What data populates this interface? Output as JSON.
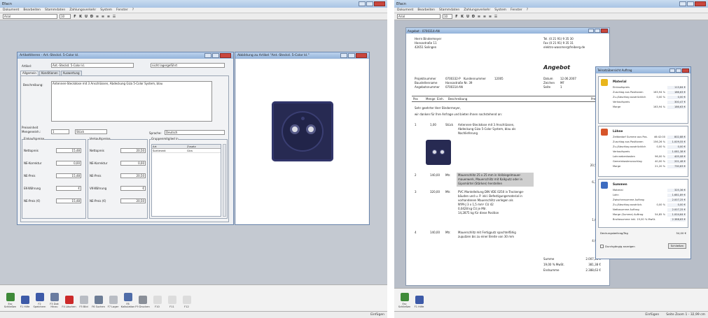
{
  "left_app": {
    "title": "Efacn",
    "menu": [
      "Dokument",
      "Bearbeiten",
      "Stammdaten",
      "Zahlungsverkehr",
      "System",
      "Fenster",
      "?"
    ],
    "font_name": "Arial",
    "font_size": "10",
    "format_buttons": [
      "F",
      "K",
      "U",
      "Ð",
      "≡",
      "≡",
      "≡",
      "☰"
    ],
    "article_window": {
      "title": "Artikeltiteren - Art.-Steckd. 5-Color kl.",
      "artikel_label": "Artikel:",
      "artikel_value": "Ant.-Steckd. 5-Color kl.",
      "lager_value": "nicht lagergeführt",
      "tabs": [
        "Allgemein",
        "Konditionen",
        "Auswertung"
      ],
      "beschreibung_label": "Beschreibung:",
      "beschreibung_value": "Antennen-Steckdose mit 3 Anschlüssen, Abdeckung Giza 5-Color System, blau",
      "preiseinheit_label": "Preiseinheit",
      "mengeneinh_label": "Mengeneinh.:",
      "preiseinheit_value": "1",
      "mengeneinh_value": "Stück",
      "sprache_label": "Sprache:",
      "sprache_value": "Deutsch",
      "gruppen_label": "Gruppenmitglied in",
      "gruppen_headers": [
        "Art",
        "Zusatz"
      ],
      "gruppen_row": [
        "Sortiment",
        "Gira"
      ],
      "einkauf_label": "Einkaufspreise",
      "verkauf_label": "Verkaufspreise",
      "einkauf_rows": [
        {
          "label": "Nettopreis",
          "value": "15,48"
        },
        {
          "label": "NE-Korrektur",
          "value": "0,00"
        },
        {
          "label": "NE-Preis",
          "value": "15,48"
        },
        {
          "label": "EK-Währung",
          "value": "€"
        },
        {
          "label": "NE-Preis (€)",
          "value": "15,48"
        }
      ],
      "verkauf_rows": [
        {
          "label": "Nettopreis",
          "value": "20,50"
        },
        {
          "label": "NE-Korrektur",
          "value": "0,00"
        },
        {
          "label": "NE-Preis",
          "value": "20,50"
        },
        {
          "label": "VK-Währung",
          "value": "€"
        },
        {
          "label": "NE-Preis (€)",
          "value": "20,50"
        }
      ]
    },
    "image_window": {
      "title": "Abbildung zu Artikel \"Ant.-Steckd. 5-Color kl.\""
    },
    "bottom_buttons": [
      {
        "label": "Esc Schließen",
        "icon": "close-door-icon",
        "color": "#3f8a3a"
      },
      {
        "label": "F1 Hilfe",
        "icon": "help-icon",
        "color": "#3d5aa8"
      },
      {
        "label": "F2 Speichern",
        "icon": "save-icon",
        "color": "#3d5aa8"
      },
      {
        "label": "F3 Dok Hinzu",
        "icon": "document-icon",
        "color": "#6a7ca0"
      },
      {
        "label": "F4 Löschen",
        "icon": "delete-icon",
        "color": "#cc2a2a"
      },
      {
        "label": "F5 Bild",
        "icon": "image-icon",
        "color": "#b9bdc4"
      },
      {
        "label": "F6 Suchen",
        "icon": "search-icon",
        "color": "#6d7d96"
      },
      {
        "label": "F7 Lager",
        "icon": "warehouse-icon",
        "color": "#b9bdc4"
      },
      {
        "label": "F8 Kalkulation",
        "icon": "calculator-icon",
        "color": "#4f6ca8"
      },
      {
        "label": "F9 Drucken",
        "icon": "print-icon",
        "color": "#8a8f98"
      },
      {
        "label": "F10",
        "icon": "blank-icon",
        "color": "#dcdcdc"
      },
      {
        "label": "F11",
        "icon": "blank-icon",
        "color": "#dcdcdc"
      },
      {
        "label": "F12",
        "icon": "blank-icon",
        "color": "#dcdcdc"
      }
    ],
    "status": "Einfügen"
  },
  "right_app": {
    "title": "Efacn",
    "menu": [
      "Dokument",
      "Bearbeiten",
      "Stammdaten",
      "Zahlungsverkehr",
      "System",
      "Fenster",
      "?"
    ],
    "font_name": "Arial",
    "font_size": "10",
    "doc_window_title": "Angebot - 0700314-AN",
    "doc": {
      "address": [
        "Herrn Bindermeyer",
        "Hansastraße 11",
        "42651 Solingen"
      ],
      "contact": [
        "Tel. (0 21 91) 9 35 30",
        "Fax (0 21 91) 9 35 31",
        "elektro-wassmer@freiberg.de"
      ],
      "heading": "Angebot",
      "meta_left": [
        {
          "label": "Projektnummer",
          "value": "0700332-P"
        },
        {
          "label": "Kundennummer",
          "value": "12005"
        },
        {
          "label": "Baustellenname",
          "value": "Hansastraße Nr. 39"
        },
        {
          "label": "Angebotsnummer",
          "value": "0700314-AN"
        }
      ],
      "meta_right": [
        {
          "label": "Datum",
          "value": "12.06.2007"
        },
        {
          "label": "Zeichen",
          "value": "MF"
        },
        {
          "label": "Seite",
          "value": "1"
        }
      ],
      "table_headers": [
        "Pos",
        "Menge",
        "Einh.",
        "Beschreibung",
        "Preis"
      ],
      "salutation": "Sehr geehrter Herr Bindermeyer,",
      "intro": "wir danken für Ihre Anfrage und bieten Ihnen nachstehend an:",
      "positions": [
        {
          "pos": "1",
          "menge": "1,00",
          "einh": "Stück",
          "text": [
            "Antennen-Steckdose mit 3 Anschlüssen,",
            "Abdeckung Giza 5-Color System, blau als",
            "Nachlieferung"
          ],
          "preis": "20,50 €",
          "highlight": false
        },
        {
          "pos": "2",
          "menge": "140,00",
          "einh": "Mtr.",
          "text": [
            "Mauerschlitz 25 x 25 mm in Vollziegelmauer-",
            "mauerwerk, Mauerschlitz mit Kalkputz oder in",
            "Gipsmörtel (Stärken) herstellen"
          ],
          "preis": "6,35 €",
          "highlight": true
        },
        {
          "pos": "3",
          "menge": "320,00",
          "einh": "Mtr.",
          "text": [
            "PVC Mantelleitung DIN VDE 0250 in Trockenge-",
            "bäuden und u. P. inkl. Befestigungsmaterial in",
            "vorhandenen Mauerschlitz verlegen als",
            "NYM-J 3 x 1,5 mm² CU 42",
            "0,0428 kg CU je Mtr.",
            "14,2875 kg für diese Position"
          ],
          "preis": "1,07 €",
          "highlight": false
        },
        {
          "pos": "4",
          "menge": "140,00",
          "einh": "Mtr.",
          "text": [
            "Mauerschlitz mit Fertigputz spachtelfähig",
            "zuputzen bis zu einer Breite von 30 mm"
          ],
          "preis": "4,93 €",
          "highlight": false
        }
      ],
      "totals": [
        {
          "label": "Summe",
          "value": "2.007,25 €"
        },
        {
          "label": "19,00 % MwSt.",
          "value": "381,38 €"
        },
        {
          "label": "Endsumme",
          "value": "2.388,63 €"
        }
      ]
    },
    "calc_window": {
      "title": "Teilsatzübersicht Auftrag",
      "sections": [
        {
          "name": "Material",
          "icon": "material-icon",
          "rows": [
            {
              "label": "Einkaufspreis",
              "pct": "",
              "value": "113,84 €"
            },
            {
              "label": "Zuschlag aus Positionen",
              "pct": "163,94 %",
              "value": "186,63 €"
            },
            {
              "label": "Zu-/Abschlag ausdrücklich",
              "pct": "0,00 %",
              "value": "0,00 €"
            },
            {
              "label": "Verkaufspreis",
              "pct": "",
              "value": "300,47 €"
            },
            {
              "label": "Marge",
              "pct": "163,94 %",
              "value": "186,63 €"
            }
          ]
        },
        {
          "name": "Löhne",
          "icon": "labor-icon",
          "rows": [
            {
              "label": "Zeitbedarf Summe aus Pos.",
              "pct": "46:42:00",
              "value": "802,88 €"
            },
            {
              "label": "Zuschlag aus Positionen",
              "pct": "156,26 %",
              "value": "1.009,55 €"
            },
            {
              "label": "Zu-/Abschlag ausdrücklich",
              "pct": "0,00 %",
              "value": "0,00 €"
            },
            {
              "label": "Verkaufspreis",
              "pct": "",
              "value": "1.081,38 €"
            },
            {
              "label": "Lohnnebenkosten",
              "pct": "96,00 %",
              "value": "405,08 €"
            },
            {
              "label": "Gemeinkostenzuschlag",
              "pct": "40,00 %",
              "value": "201,48 €"
            },
            {
              "label": "Marge",
              "pct": "21,20 %",
              "value": "730,83 €"
            }
          ]
        },
        {
          "name": "Summen",
          "icon": "sum-icon",
          "rows": [
            {
              "label": "Material",
              "pct": "",
              "value": "325,36 €"
            },
            {
              "label": "Lohn",
              "pct": "",
              "value": "1.681,89 €"
            },
            {
              "label": "Zwischensumme Auftrag",
              "pct": "",
              "value": "2.007,25 €"
            },
            {
              "label": "Zu-/Abschlag ausdrück.",
              "pct": "0,00 %",
              "value": "0,00 €"
            },
            {
              "label": "Nettosumme Auftrag",
              "pct": "",
              "value": "2.007,25 €"
            },
            {
              "label": "Marge (Summe) Auftrag",
              "pct": "54,85 %",
              "value": "1.004,64 €"
            },
            {
              "label": "Bruttosumme inkl. 19,00 % MwSt.",
              "pct": "",
              "value": "2.388,63 €"
            }
          ]
        }
      ],
      "deckung_label": "Deckungsbeitrag/Tag",
      "deckung_value": "54,00 €",
      "checkbox_label": "Durchgängig anzeigen",
      "close_label": "Schließen"
    },
    "bottom_buttons": [
      {
        "label": "Esc Schließen",
        "icon": "close-door-icon",
        "color": "#3f8a3a"
      },
      {
        "label": "F1 Hilfe",
        "icon": "help-icon",
        "color": "#3d5aa8"
      }
    ],
    "status_left": "Einfügen",
    "status_right": "Seite Zoom 1 - 32,99 cm"
  }
}
